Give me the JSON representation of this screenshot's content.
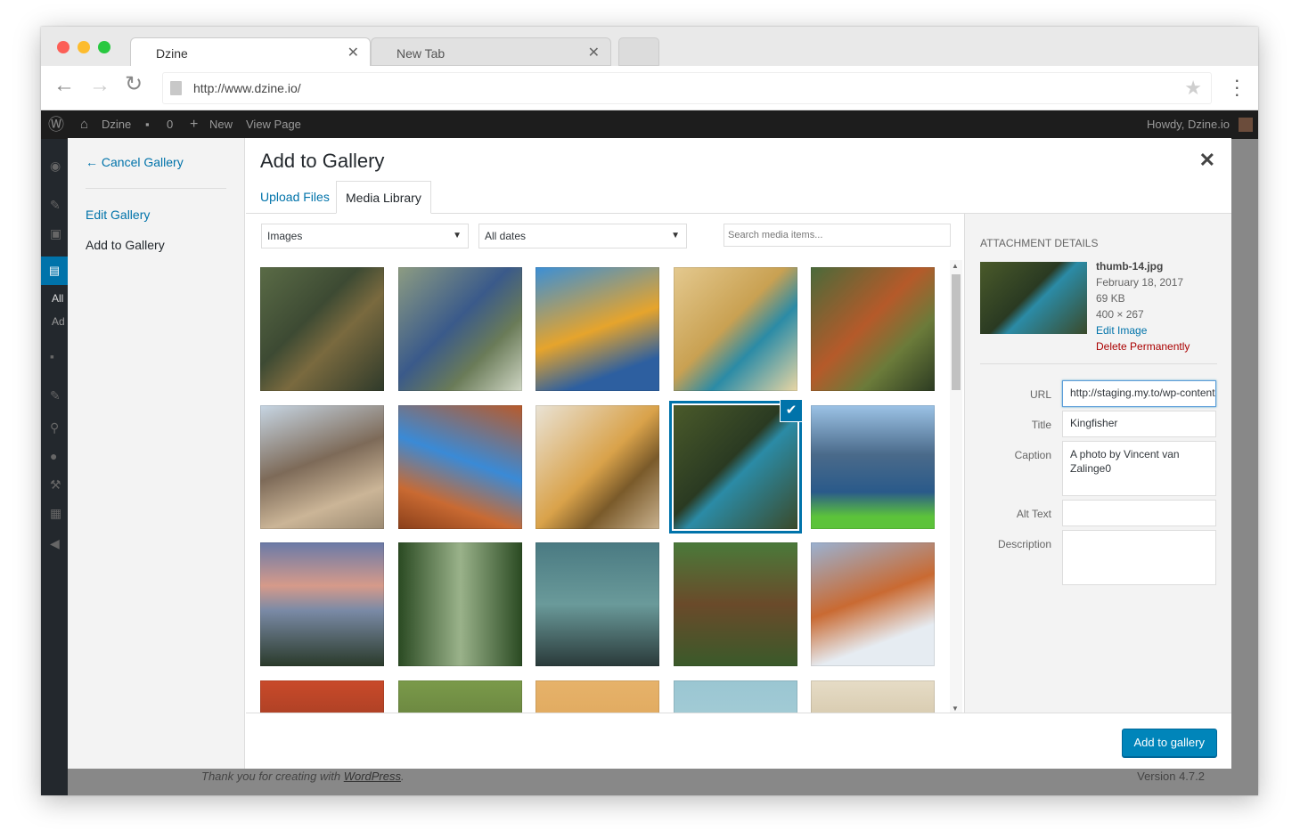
{
  "browser": {
    "tabs": [
      {
        "title": "Dzine"
      },
      {
        "title": "New Tab"
      }
    ],
    "url": "http://www.dzine.io/"
  },
  "adminbar": {
    "site_name": "Dzine",
    "comments_count": "0",
    "new_label": "New",
    "view_page_label": "View Page",
    "howdy": "Howdy, Dzine.io"
  },
  "sidebar": {
    "all_label": "All",
    "add_label": "Ad"
  },
  "footer": {
    "thanks_prefix": "Thank you for creating with",
    "thanks_link": "WordPress",
    "thanks_suffix": ".",
    "version": "Version 4.7.2"
  },
  "modal": {
    "cancel_label": "← Cancel Gallery",
    "menu": [
      "Edit Gallery",
      "Add to Gallery"
    ],
    "title": "Add to Gallery",
    "tabs": [
      "Upload Files",
      "Media Library"
    ],
    "filter_type": "Images",
    "filter_date": "All dates",
    "search_placeholder": "Search media items...",
    "add_button": "Add to gallery"
  },
  "attachment": {
    "header": "Attachment Details",
    "filename": "thumb-14.jpg",
    "date": "February 18, 2017",
    "size": "69 KB",
    "dimensions": "400 × 267",
    "edit_link": "Edit Image",
    "delete_link": "Delete Permanently",
    "labels": {
      "url": "URL",
      "title": "Title",
      "caption": "Caption",
      "alt": "Alt Text",
      "description": "Description"
    },
    "values": {
      "url": "http://staging.my.to/wp-content",
      "title": "Kingfisher",
      "caption": "A photo by Vincent van Zalinge0",
      "alt": "",
      "description": ""
    }
  },
  "colors": {
    "accent": "#0073aa",
    "button": "#0085ba",
    "delete": "#a00",
    "link": "#0073aa"
  }
}
